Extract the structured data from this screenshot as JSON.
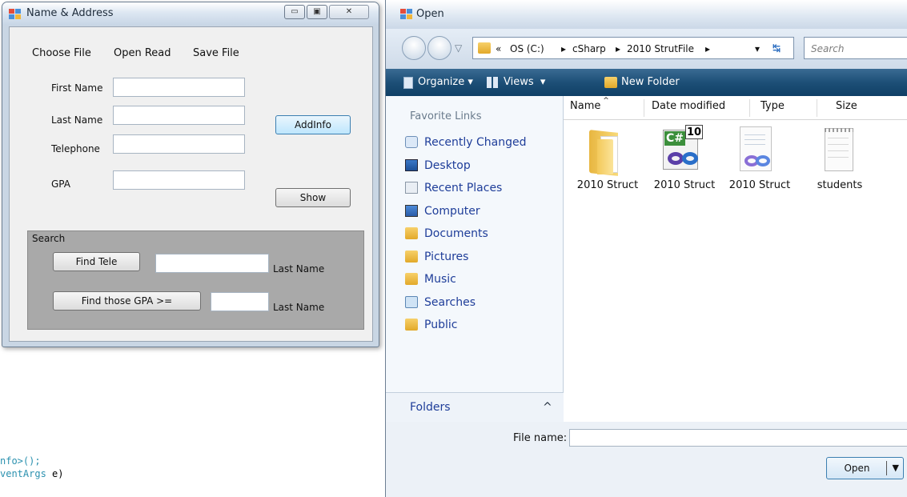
{
  "background_code": {
    "line1": "nfo>();",
    "line2_type": "ventArgs",
    "line2_rest": " e)"
  },
  "name_address_window": {
    "title": "Name & Address",
    "caption_buttons": {
      "minimize": "▭",
      "maximize": "▣",
      "close": "✕"
    },
    "menu": [
      "Choose File",
      "Open Read",
      "Save File"
    ],
    "fields": {
      "first_name": {
        "label": "First Name",
        "value": ""
      },
      "last_name": {
        "label": "Last Name",
        "value": ""
      },
      "telephone": {
        "label": "Telephone",
        "value": ""
      },
      "gpa": {
        "label": "GPA",
        "value": ""
      }
    },
    "buttons": {
      "add_info": "AddInfo",
      "show": "Show"
    },
    "search": {
      "legend": "Search",
      "find_tele_button": "Find Tele",
      "tele_value": "",
      "tele_result_label": "Last Name",
      "find_gpa_button": "Find those GPA >=",
      "gpa_value": "",
      "gpa_result_label": "Last Name"
    }
  },
  "open_dialog": {
    "title": "Open",
    "breadcrumb": [
      "«",
      "OS (C:)",
      "cSharp",
      "2010 StrutFile"
    ],
    "search_placeholder": "Search",
    "commands": {
      "organize": "Organize",
      "views": "Views",
      "new_folder": "New Folder"
    },
    "favorites_heading": "Favorite Links",
    "favorites": [
      {
        "label": "Recently Changed",
        "icon": "recently-changed-icon"
      },
      {
        "label": "Desktop",
        "icon": "desktop-icon"
      },
      {
        "label": "Recent Places",
        "icon": "recent-places-icon"
      },
      {
        "label": "Computer",
        "icon": "computer-icon"
      },
      {
        "label": "Documents",
        "icon": "folder-icon"
      },
      {
        "label": "Pictures",
        "icon": "folder-icon"
      },
      {
        "label": "Music",
        "icon": "folder-icon"
      },
      {
        "label": "Searches",
        "icon": "searches-icon"
      },
      {
        "label": "Public",
        "icon": "folder-icon"
      }
    ],
    "folders_label": "Folders",
    "columns": [
      "Name",
      "Date modified",
      "Type",
      "Size"
    ],
    "files": [
      {
        "label": "2010 Struct",
        "icon": "folder-icon"
      },
      {
        "label": "2010 Struct",
        "icon": "csharp-project-icon"
      },
      {
        "label": "2010 Struct",
        "icon": "solution-file-icon"
      },
      {
        "label": "students",
        "icon": "text-file-icon"
      }
    ],
    "csharp_badge": "10",
    "file_name_label": "File name:",
    "file_name_value": "",
    "open_button": "Open"
  },
  "colors": {
    "accent_blue": "#1e3d99",
    "command_bar": "#1d4f77",
    "group_box": "#a9a9a9"
  }
}
